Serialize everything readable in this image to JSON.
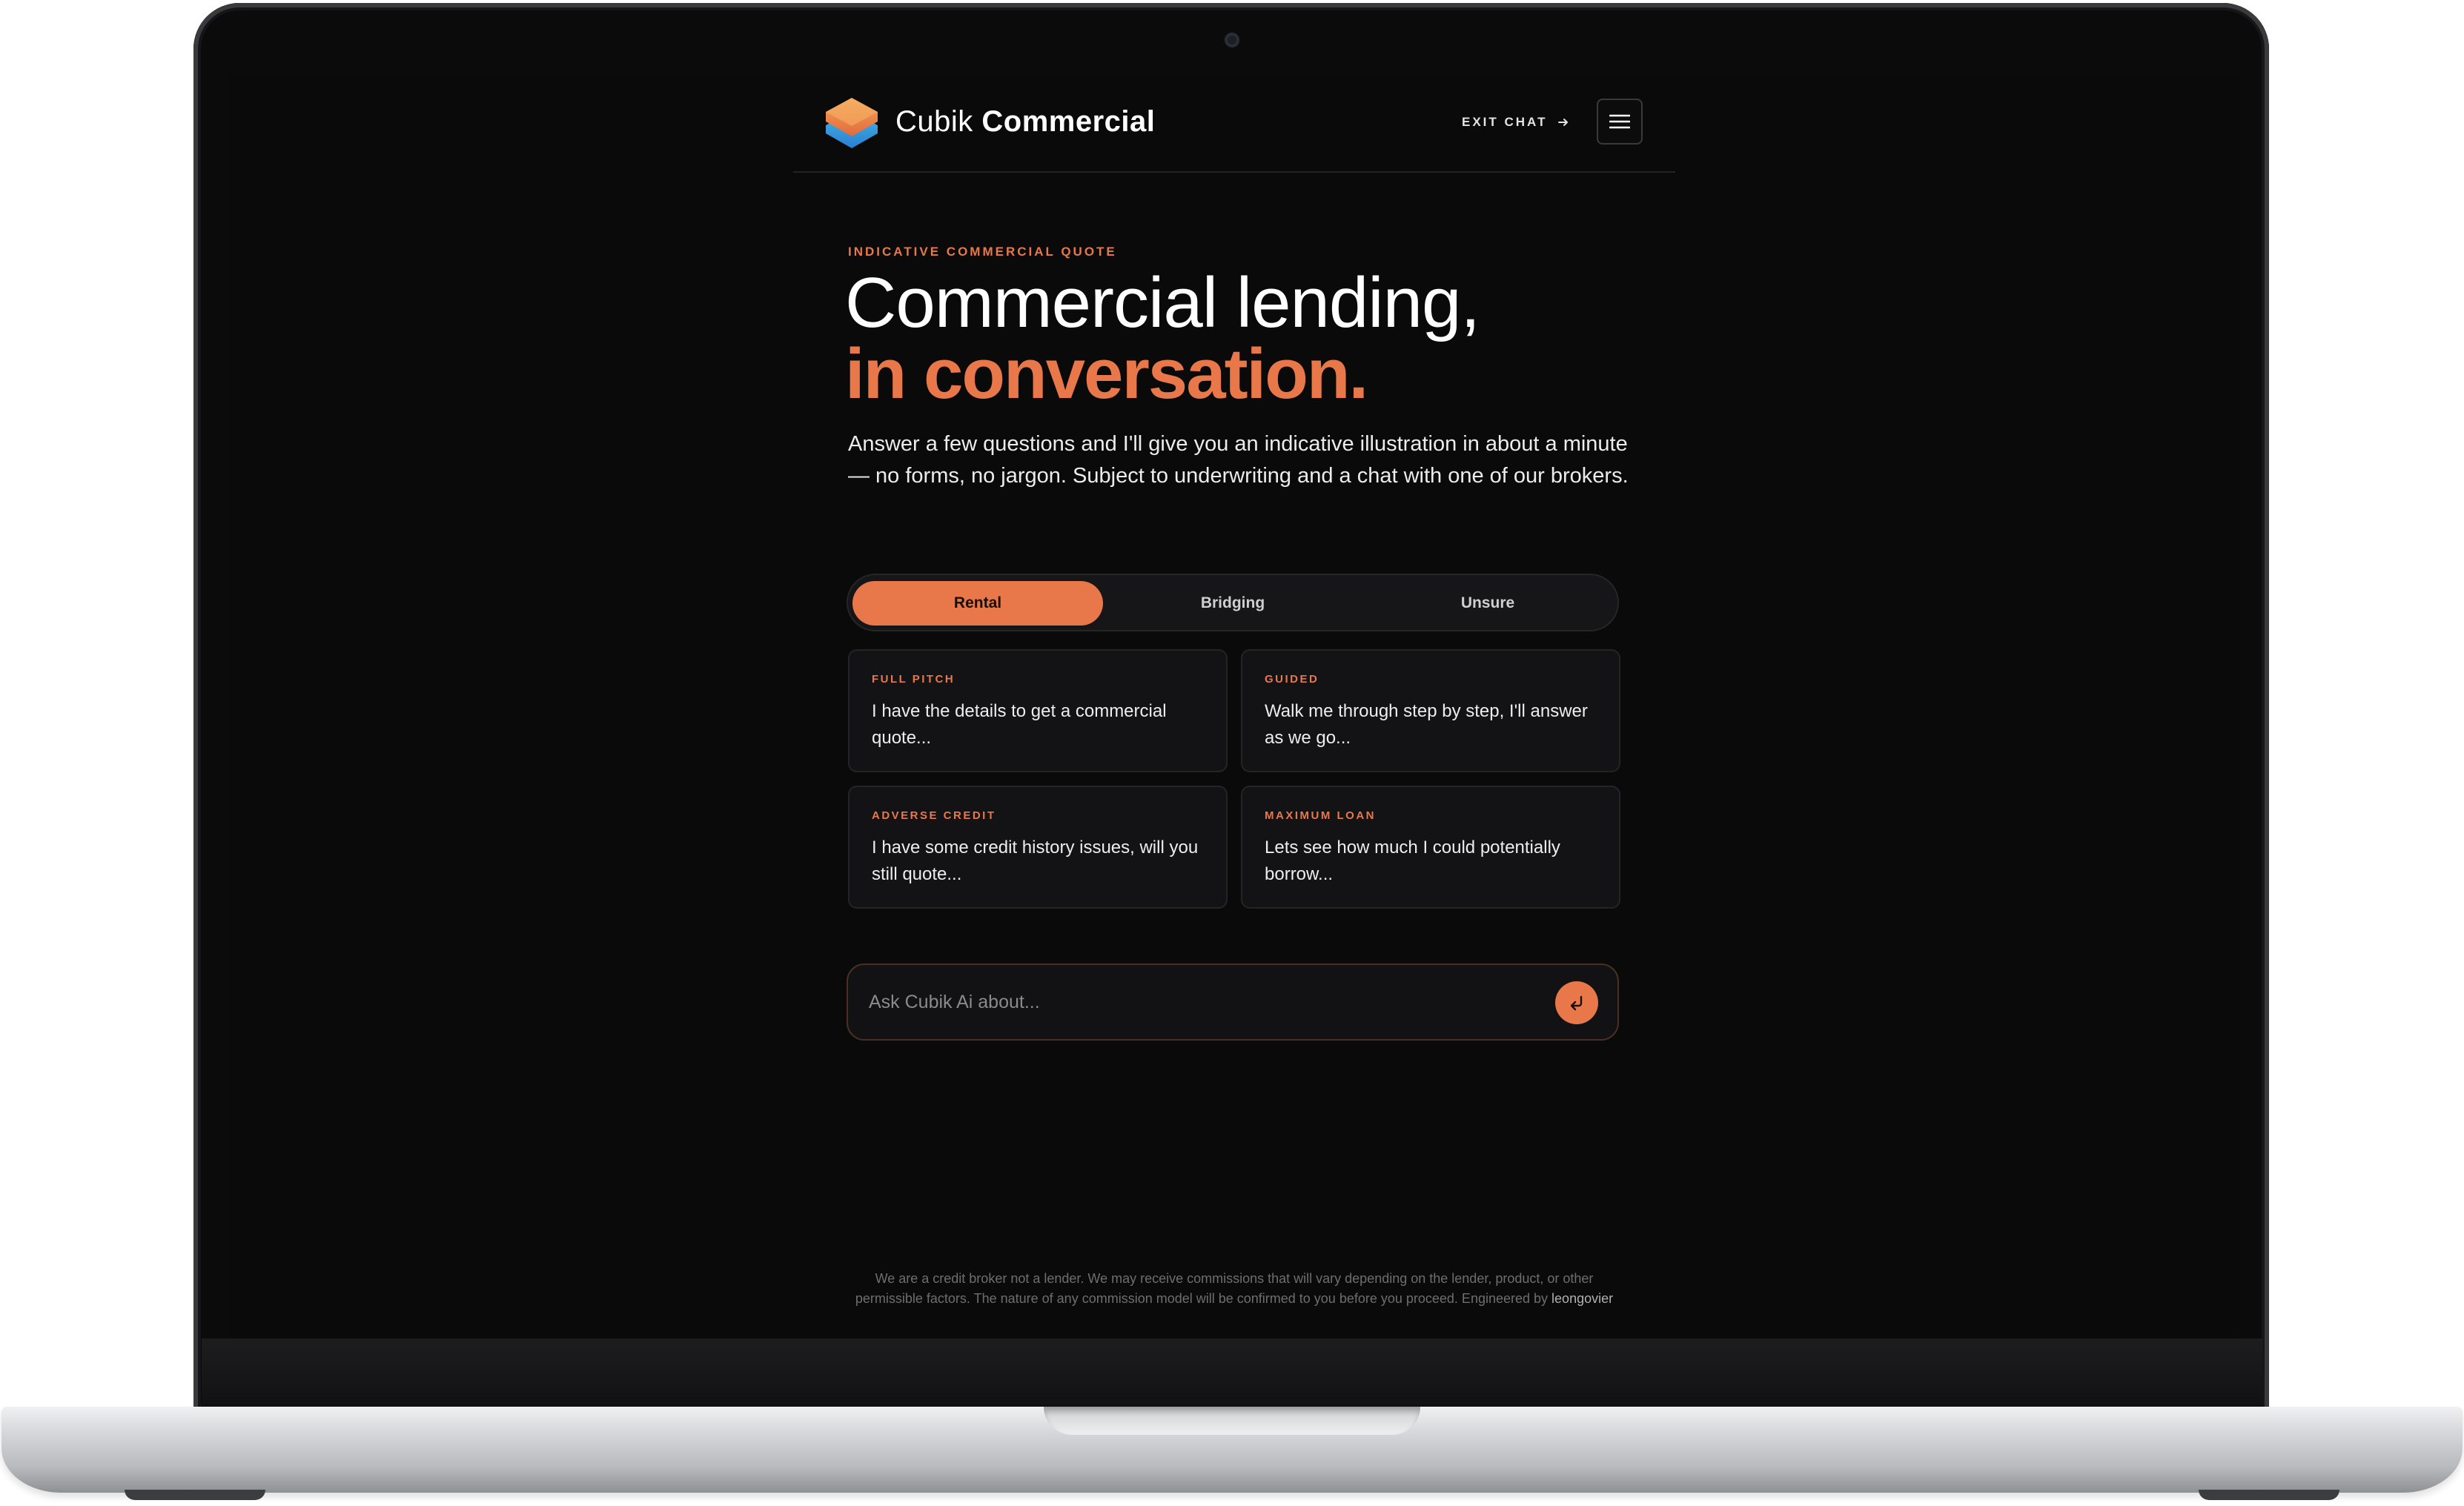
{
  "colors": {
    "accent": "#e8784a",
    "background": "#0a0a0a",
    "card": "#131315"
  },
  "header": {
    "brand_light": "Cubik",
    "brand_bold": "Commercial",
    "exit_label": "EXIT CHAT",
    "logo_icon": "cube-logo-icon",
    "menu_icon": "hamburger-menu-icon"
  },
  "hero": {
    "eyebrow": "INDICATIVE COMMERCIAL QUOTE",
    "title_line1": "Commercial lending,",
    "title_line2": "in conversation.",
    "intro": "Answer a few questions and I'll give you an indicative illustration in about a minute — no forms, no jargon. Subject to underwriting and a chat with one of our brokers."
  },
  "loan_types": {
    "selected": "Rental",
    "options": [
      "Rental",
      "Bridging",
      "Unsure"
    ]
  },
  "cards": [
    {
      "tag": "FULL PITCH",
      "text": "I have the details to get a commercial quote..."
    },
    {
      "tag": "GUIDED",
      "text": "Walk me through step by step, I'll answer as we go..."
    },
    {
      "tag": "ADVERSE CREDIT",
      "text": "I have some credit history issues, will you still quote..."
    },
    {
      "tag": "MAXIMUM LOAN",
      "text": "Lets see how much I could potentially borrow..."
    }
  ],
  "ask": {
    "placeholder": "Ask Cubik Ai about...",
    "value": "",
    "send_icon": "return-arrow-icon"
  },
  "footer": {
    "disclaimer_line1": "We are a credit broker not a lender. We may receive commissions that will vary depending on the lender, product, or other",
    "disclaimer_line2": "permissible factors. The nature of any commission model will be confirmed to you before you proceed. Engineered by",
    "engineer": "leongovier"
  }
}
